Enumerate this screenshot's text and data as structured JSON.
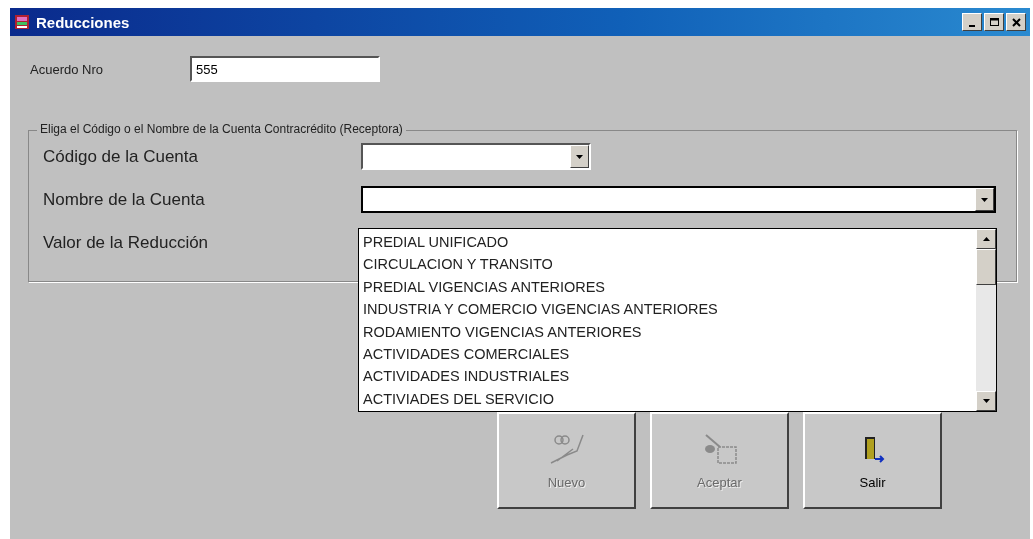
{
  "window": {
    "title": "Reducciones"
  },
  "agreement": {
    "label": "Acuerdo Nro",
    "value": "555"
  },
  "group": {
    "legend": "Eliga el Código o el Nombre de la Cuenta Contracrédito (Receptora)",
    "fields": [
      {
        "label": "Código de la Cuenta",
        "kind": "short-combo"
      },
      {
        "label": "Nombre de la Cuenta",
        "kind": "long-combo",
        "expanded": true
      },
      {
        "label": "Valor de la Reducción",
        "kind": "plain"
      }
    ]
  },
  "dropdown": {
    "items": [
      "PREDIAL UNIFICADO",
      "CIRCULACION Y TRANSITO",
      "PREDIAL VIGENCIAS ANTERIORES",
      "INDUSTRIA Y COMERCIO VIGENCIAS ANTERIORES",
      "RODAMIENTO VIGENCIAS ANTERIORES",
      "ACTIVIDADES COMERCIALES",
      "ACTIVIDADES INDUSTRIALES",
      "ACTIVIADES DEL SERVICIO"
    ]
  },
  "buttons": [
    {
      "label": "Nuevo",
      "kind": "new",
      "disabled": true
    },
    {
      "label": "Aceptar",
      "kind": "accept",
      "disabled": true
    },
    {
      "label": "Salir",
      "kind": "exit",
      "disabled": false
    }
  ]
}
